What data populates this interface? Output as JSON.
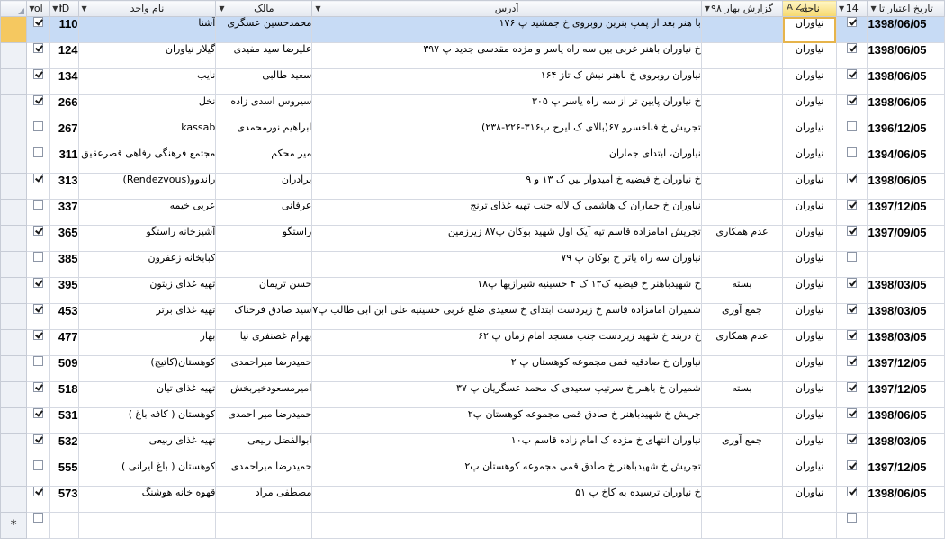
{
  "columns": {
    "sel": "",
    "ol": "ol",
    "id": "ID",
    "unit_name": "نام واحد",
    "owner": "مالک",
    "address": "آدرس",
    "report": "گزارش بهار ۹۸",
    "region": "ناحیه",
    "c14": "14",
    "valid_date": "تاریخ اعتبار تا"
  },
  "rows": [
    {
      "ol": true,
      "id": "110",
      "name": "آشنا",
      "owner": "محمدحسین عسگری",
      "address": "با هنر بعد از پمپ بنزین روبروی خ جمشید پ ۱۷۶",
      "report": "",
      "region": "نیاوران",
      "c14": true,
      "date": "1398/06/05",
      "current": true
    },
    {
      "ol": true,
      "id": "124",
      "name": "گیلار نیاوران",
      "owner": "علیرضا سید مفیدی",
      "address": "خ نیاوران باهنر غربی بین سه راه یاسر و مژده مقدسی جدید پ ۳۹۷",
      "report": "",
      "region": "نیاوران",
      "c14": true,
      "date": "1398/06/05"
    },
    {
      "ol": true,
      "id": "134",
      "name": "نایب",
      "owner": "سعید طالبی",
      "address": "نیاوران روبروی  خ باهنر نبش ک تاز  ۱۶۴",
      "report": "",
      "region": "نیاوران",
      "c14": true,
      "date": "1398/06/05"
    },
    {
      "ol": true,
      "id": "266",
      "name": "نخل",
      "owner": "سیروس اسدی زاده",
      "address": "خ نیاوران پایین تر از سه راه یاسر پ ۳۰۵",
      "report": "",
      "region": "نیاوران",
      "c14": true,
      "date": "1398/06/05"
    },
    {
      "ol": false,
      "id": "267",
      "name": "kassab",
      "owner": "ابراهیم نورمحمدی",
      "address": "تجریش خ فناخسرو ۶۷(بالای ک ایرج  پ۳۱۶-۳۲۶-۲۳۸)",
      "report": "",
      "region": "نیاوران",
      "c14": false,
      "date": "1396/12/05"
    },
    {
      "ol": false,
      "id": "311",
      "name": "مجتمع فرهنگی رفاهی قصرعقیق",
      "owner": "میر محکم",
      "address": "نیاوران، ابتدای جماران",
      "report": "",
      "region": "نیاوران",
      "c14": false,
      "date": "1394/06/05"
    },
    {
      "ol": true,
      "id": "313",
      "name": "راندوو(Rendezvous)",
      "owner": "برادران",
      "address": "خ نیاوران خ فیضیه خ امیدوار بین ک ۱۳ و ۹",
      "report": "",
      "region": "نیاوران",
      "c14": true,
      "date": "1398/06/05"
    },
    {
      "ol": false,
      "id": "337",
      "name": "عربی خیمه",
      "owner": "عرفانی",
      "address": "نیاوران خ جماران ک هاشمی ک لاله جنب تهیه غذای ترنج",
      "report": "",
      "region": "نیاوران",
      "c14": true,
      "date": "1397/12/05"
    },
    {
      "ol": true,
      "id": "365",
      "name": "آشپزخانه راستگو",
      "owner": "راستگو",
      "address": "تجریش امامزاده قاسم  تپه آیک اول شهید بوکان پ۸۷ زیرزمین",
      "report": "عدم همکاری",
      "region": "نیاوران",
      "c14": true,
      "date": "1397/09/05"
    },
    {
      "ol": false,
      "id": "385",
      "name": "کبابخانه زعفرون",
      "owner": "",
      "address": "نیاوران سه راه یاثر خ بوکان پ ۷۹",
      "report": "",
      "region": "نیاوران",
      "c14": false,
      "date": ""
    },
    {
      "ol": true,
      "id": "395",
      "name": "تهیه غذای زیتون",
      "owner": "حسن تریمان",
      "address": "خ شهیدباهنر خ فیضیه ک۱۳ ک ۴ حسینیه شیرازیها پ۱۸",
      "report": "بسته",
      "region": "نیاوران",
      "c14": true,
      "date": "1398/03/05"
    },
    {
      "ol": true,
      "id": "453",
      "name": "تهیه غذای برتر",
      "owner": "سید صادق فرحناک",
      "address": "شمیران امامزاده قاسم خ زیردست ابتدای خ سعیدی ضلع غربی حسینیه علی ابن ابی طالب پ۷",
      "report": "جمع آوری",
      "region": "نیاوران",
      "c14": true,
      "date": "1398/03/05"
    },
    {
      "ol": true,
      "id": "477",
      "name": "بهار",
      "owner": "بهرام غضنفری نیا",
      "address": "خ دربند خ شهید زیردست جنب مسجد امام زمان پ ۶۲",
      "report": "عدم همکاری",
      "region": "نیاوران",
      "c14": true,
      "date": "1398/03/05"
    },
    {
      "ol": false,
      "id": "509",
      "name": "کوهستان(کاتیج)",
      "owner": "حمیدرضا میراحمدی",
      "address": "نیاوران خ صادقیه قمی مجموعه کوهستان پ ۲",
      "report": "",
      "region": "نیاوران",
      "c14": true,
      "date": "1397/12/05"
    },
    {
      "ol": true,
      "id": "518",
      "name": "تهیه غذای تیان",
      "owner": "امیرمسعودخیربخش",
      "address": "شمیران خ باهنر خ سرتیپ سعیدی ک محمد عسگریان پ ۳۷",
      "report": "بسته",
      "region": "نیاوران",
      "c14": true,
      "date": "1397/12/05"
    },
    {
      "ol": true,
      "id": "531",
      "name": "کوهستان ( کافه باغ )",
      "owner": "حمیدرضا میر احمدی",
      "address": "جریش خ شهیدباهنر خ صادق قمی مجموعه کوهستان پ۲",
      "report": "",
      "region": "نیاوران",
      "c14": true,
      "date": "1398/06/05"
    },
    {
      "ol": true,
      "id": "532",
      "name": "تهیه غذای ربیعی",
      "owner": "ابوالفضل ربیعی",
      "address": "نیاوران انتهای خ مژده ک امام زاده قاسم پ۱۰",
      "report": "جمع آوری",
      "region": "نیاوران",
      "c14": true,
      "date": "1398/03/05"
    },
    {
      "ol": false,
      "id": "555",
      "name": "کوهستان ( باغ ایرانی )",
      "owner": "حمیدرضا میراحمدی",
      "address": "تجریش خ شهیدباهنر خ صادق قمی مجموعه کوهستان پ۲",
      "report": "",
      "region": "نیاوران",
      "c14": true,
      "date": "1397/12/05"
    },
    {
      "ol": true,
      "id": "573",
      "name": "قهوه خانه هوشنگ",
      "owner": "مصطفی مراد",
      "address": "خ نیاوران ترسیده به کاخ پ ۵۱",
      "report": "",
      "region": "نیاوران",
      "c14": true,
      "date": "1398/06/05"
    }
  ],
  "new_row_marker": "*"
}
